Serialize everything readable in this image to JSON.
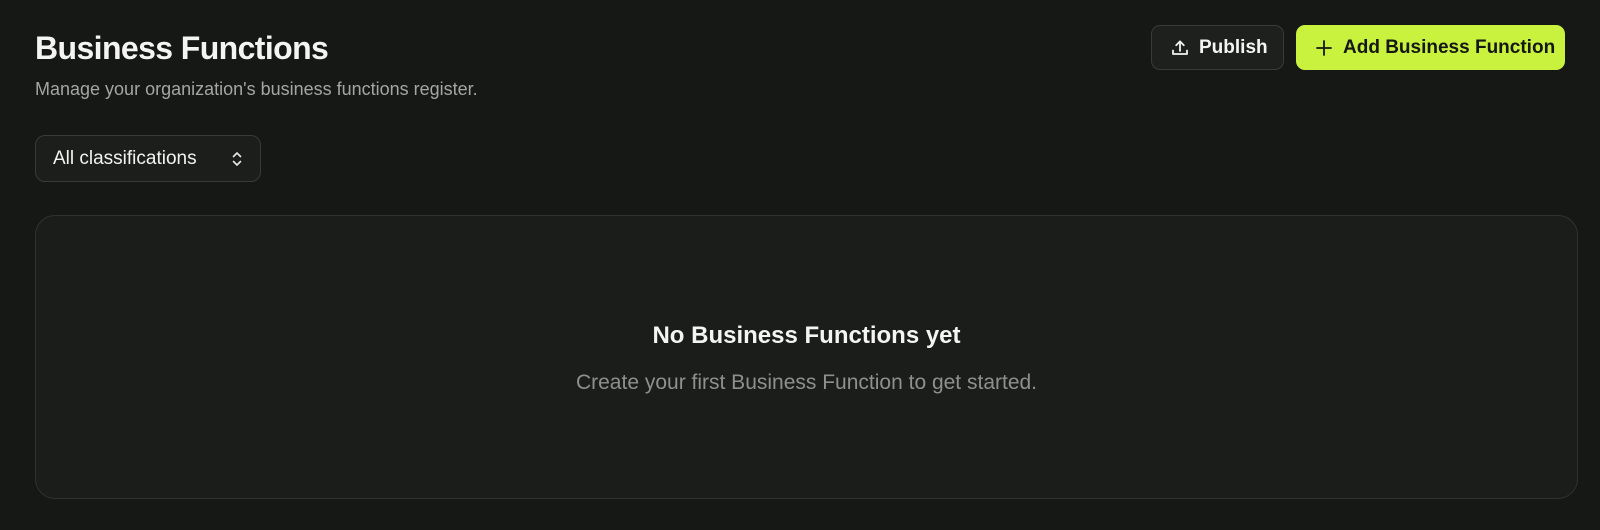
{
  "header": {
    "title": "Business Functions",
    "subtitle": "Manage your organization's business functions register."
  },
  "actions": {
    "publish_label": "Publish",
    "publish_icon": "upload-icon",
    "add_label": "Add Business Function",
    "add_icon": "plus-icon"
  },
  "filter": {
    "selected": "All classifications",
    "icon": "chevron-up-down-icon"
  },
  "empty_state": {
    "title": "No Business Functions yet",
    "description": "Create your first Business Function to get started."
  },
  "colors": {
    "background": "#161816",
    "accent": "#c9f23f",
    "card": "#1b1d1a"
  }
}
